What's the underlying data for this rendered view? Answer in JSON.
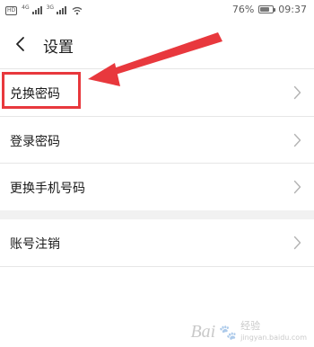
{
  "status_bar": {
    "hd_badge": "HD",
    "network_1": "4G",
    "network_2": "3G",
    "battery_percent": "76%",
    "battery_level": 0.76,
    "time": "09:37"
  },
  "header": {
    "back_icon": "chevron-left-icon",
    "title": "设置"
  },
  "list": {
    "items": [
      {
        "label": "兑换密码",
        "icon": "chevron-right-icon",
        "highlighted": true
      },
      {
        "label": "登录密码",
        "icon": "chevron-right-icon"
      },
      {
        "label": "更换手机号码",
        "icon": "chevron-right-icon"
      },
      {
        "label": "账号注销",
        "icon": "chevron-right-icon"
      }
    ]
  },
  "watermark": {
    "brand": "Bai",
    "brand_suffix": "经验",
    "url": "jingyan.baidu.com"
  },
  "colors": {
    "annotation_red": "#e8383d",
    "divider": "#e6e6e6",
    "section_gap": "#f1f1f1",
    "text_primary": "#1a1a1a",
    "chevron": "#b3b3b3"
  }
}
